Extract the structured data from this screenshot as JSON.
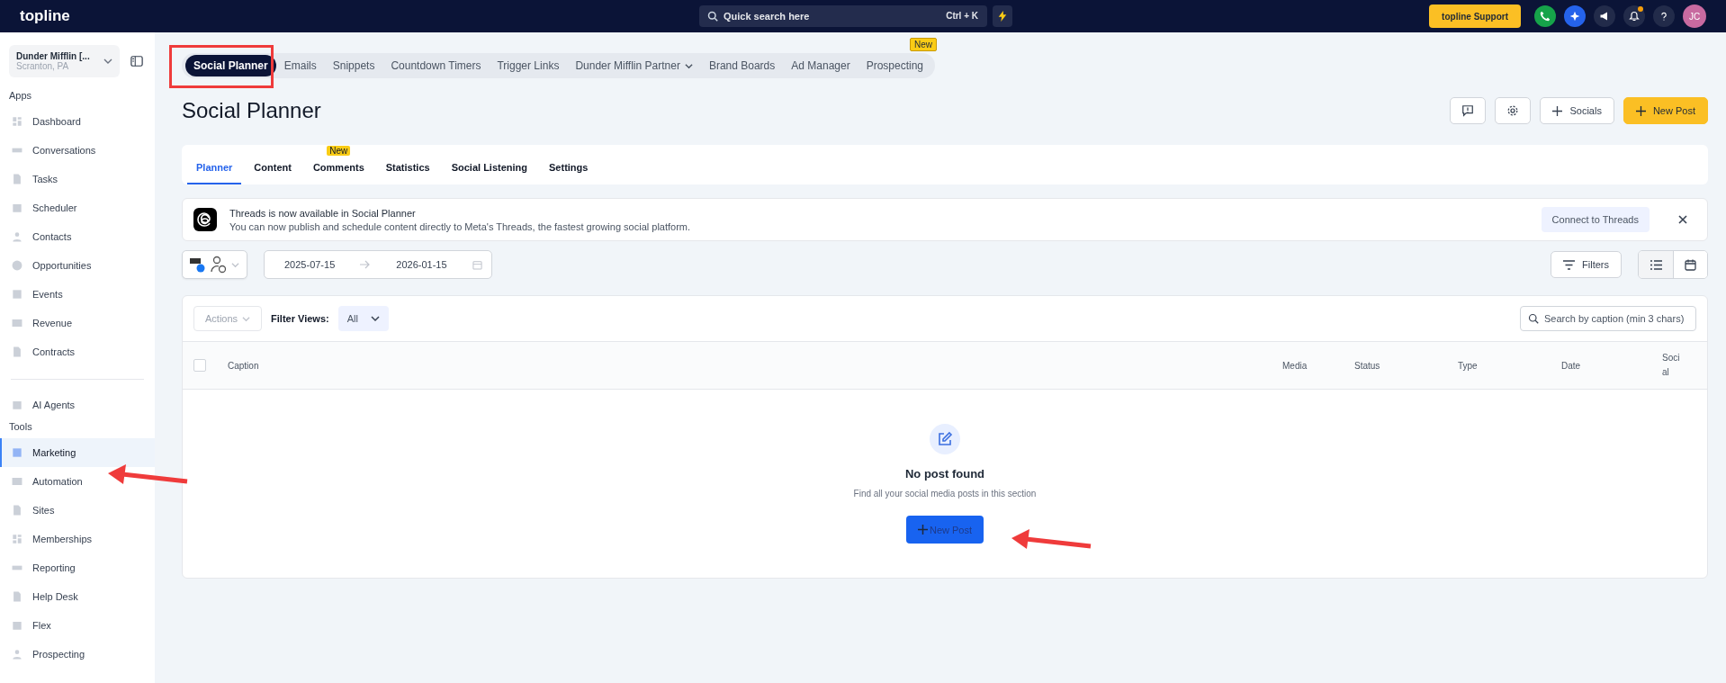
{
  "topbar": {
    "logo": "topline",
    "search": {
      "placeholder": "Quick search here",
      "shortcut": "Ctrl + K"
    },
    "support": "topline Support",
    "notification": true,
    "avatar": "JC"
  },
  "account": {
    "name": "Dunder Mifflin [...",
    "location": "Scranton, PA"
  },
  "sidebar": {
    "sections": [
      {
        "title": "Apps",
        "items": [
          {
            "label": "Dashboard",
            "selected": false
          },
          {
            "label": "Conversations",
            "selected": false
          },
          {
            "label": "Tasks",
            "selected": false
          },
          {
            "label": "Scheduler",
            "selected": false
          },
          {
            "label": "Contacts",
            "selected": false
          },
          {
            "label": "Opportunities",
            "selected": false
          },
          {
            "label": "Events",
            "selected": false
          },
          {
            "label": "Revenue",
            "selected": false
          },
          {
            "label": "Contracts",
            "selected": false
          }
        ]
      },
      {
        "items": [
          {
            "label": "AI Agents",
            "selected": false
          }
        ]
      },
      {
        "title": "Tools",
        "items": [
          {
            "label": "Marketing",
            "selected": true
          },
          {
            "label": "Automation",
            "selected": false
          },
          {
            "label": "Sites",
            "selected": false
          },
          {
            "label": "Memberships",
            "selected": false
          },
          {
            "label": "Reporting",
            "selected": false
          },
          {
            "label": "Help Desk",
            "selected": false
          },
          {
            "label": "Flex",
            "selected": false
          },
          {
            "label": "Prospecting",
            "selected": false
          }
        ]
      }
    ]
  },
  "module_tabs": [
    {
      "label": "Social Planner",
      "selected": true
    },
    {
      "label": "Emails",
      "selected": false
    },
    {
      "label": "Snippets",
      "selected": false
    },
    {
      "label": "Countdown Timers",
      "selected": false
    },
    {
      "label": "Trigger Links",
      "selected": false
    },
    {
      "label": "Dunder Mifflin Partner",
      "selected": false,
      "dropdown": true
    },
    {
      "label": "Brand Boards",
      "selected": false
    },
    {
      "label": "Ad Manager",
      "selected": false
    },
    {
      "label": "Prospecting",
      "selected": false,
      "badge": "New"
    }
  ],
  "page_title": "Social Planner",
  "header_actions": {
    "socials": "Socials",
    "new_post": "New Post"
  },
  "tabs": [
    {
      "label": "Planner",
      "selected": true
    },
    {
      "label": "Content",
      "selected": false
    },
    {
      "label": "Comments",
      "selected": false,
      "badge": "New"
    },
    {
      "label": "Statistics",
      "selected": false
    },
    {
      "label": "Social Listening",
      "selected": false
    },
    {
      "label": "Settings",
      "selected": false
    }
  ],
  "banner": {
    "title": "Threads is now available in Social Planner",
    "text": "You can now publish and schedule content directly to Meta's Threads, the fastest growing social platform.",
    "action": "Connect to Threads"
  },
  "toolbar": {
    "date_from": "2025-07-15",
    "date_to": "2026-01-15",
    "filters": "Filters",
    "view_list_selected": true
  },
  "table": {
    "actions": "Actions",
    "filter_label": "Filter Views:",
    "filter_value": "All",
    "search_placeholder": "Search by caption (min 3 chars)",
    "select_all_checked": false,
    "columns": [
      "Caption",
      "Media",
      "Status",
      "Type",
      "Date",
      "Social"
    ]
  },
  "empty_state": {
    "title": "No post found",
    "text": "Find all your social media posts in this section",
    "button": "New Post"
  }
}
